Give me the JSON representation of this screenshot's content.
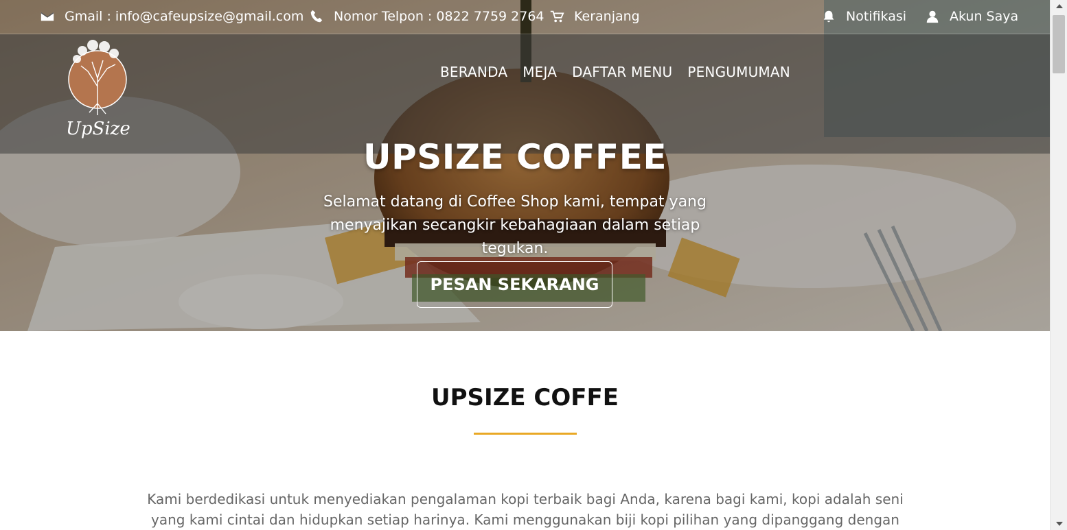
{
  "topbar": {
    "email": "Gmail : info@cafeupsize@gmail.com",
    "phone": "Nomor Telpon : 0822 7759 2764",
    "cart": "Keranjang",
    "notifications": "Notifikasi",
    "account": "Akun Saya"
  },
  "logo": {
    "text": "UpSize"
  },
  "nav": {
    "items": [
      "BERANDA",
      "MEJA",
      "DAFTAR MENU",
      "PENGUMUMAN"
    ]
  },
  "hero": {
    "title": "UPSIZE COFFEE",
    "subtitle": "Selamat datang di Coffee Shop kami, tempat yang menyajikan secangkir kebahagiaan dalam setiap tegukan.",
    "cta": "PESAN SEKARANG"
  },
  "about": {
    "title": "UPSIZE COFFE",
    "text": "Kami berdedikasi untuk menyediakan pengalaman kopi terbaik bagi Anda, karena bagi kami, kopi adalah seni yang kami cintai dan hidupkan setiap harinya. Kami menggunakan biji kopi pilihan yang dipanggang dengan penuh keahlian untuk"
  },
  "colors": {
    "accent": "#e9a825",
    "navband": "#3c3c3c"
  }
}
